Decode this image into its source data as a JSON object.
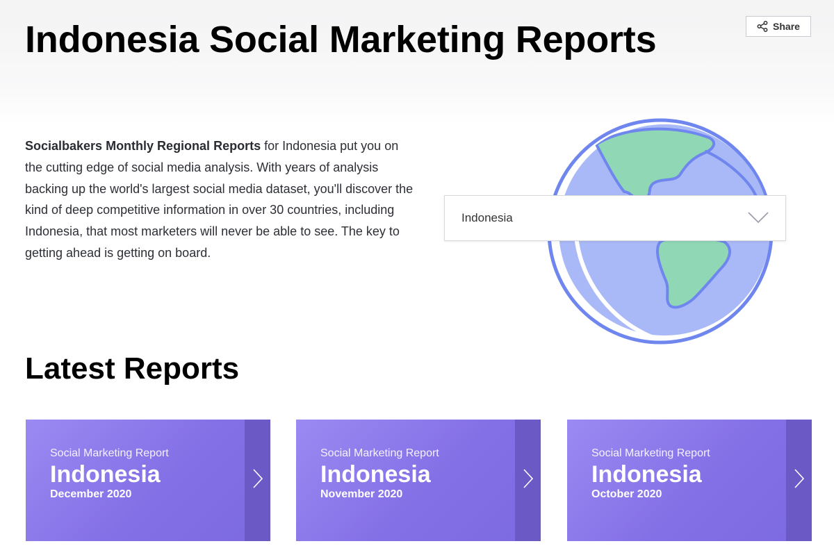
{
  "header": {
    "title": "Indonesia Social Marketing Reports",
    "share_label": "Share"
  },
  "intro": {
    "bold_lead": "Socialbakers Monthly Regional Reports",
    "text": " for Indonesia put you on the cutting edge of social media analysis. With years of analysis backing up the world's largest social media dataset, you'll discover the kind of deep competitive information in over 30 countries, including Indonesia, that most marketers will never be able to see. The key to getting ahead is getting on board."
  },
  "country_select": {
    "value": "Indonesia"
  },
  "latest": {
    "heading": "Latest Reports",
    "cards": [
      {
        "kicker": "Social Marketing Report",
        "country": "Indonesia",
        "month": "December 2020"
      },
      {
        "kicker": "Social Marketing Report",
        "country": "Indonesia",
        "month": "November 2020"
      },
      {
        "kicker": "Social Marketing Report",
        "country": "Indonesia",
        "month": "October 2020"
      }
    ]
  },
  "colors": {
    "card_gradient_start": "#9b8af2",
    "card_gradient_end": "#7c6ae0",
    "card_strip": "#6b59c6",
    "globe_ocean": "#a9b8f6",
    "globe_outline": "#6f86ee",
    "globe_land": "#8fd7b5"
  },
  "icons": {
    "share": "share-icon",
    "dropdown": "chevron-down-icon",
    "card_arrow": "chevron-right-icon",
    "illustration": "globe-icon"
  }
}
